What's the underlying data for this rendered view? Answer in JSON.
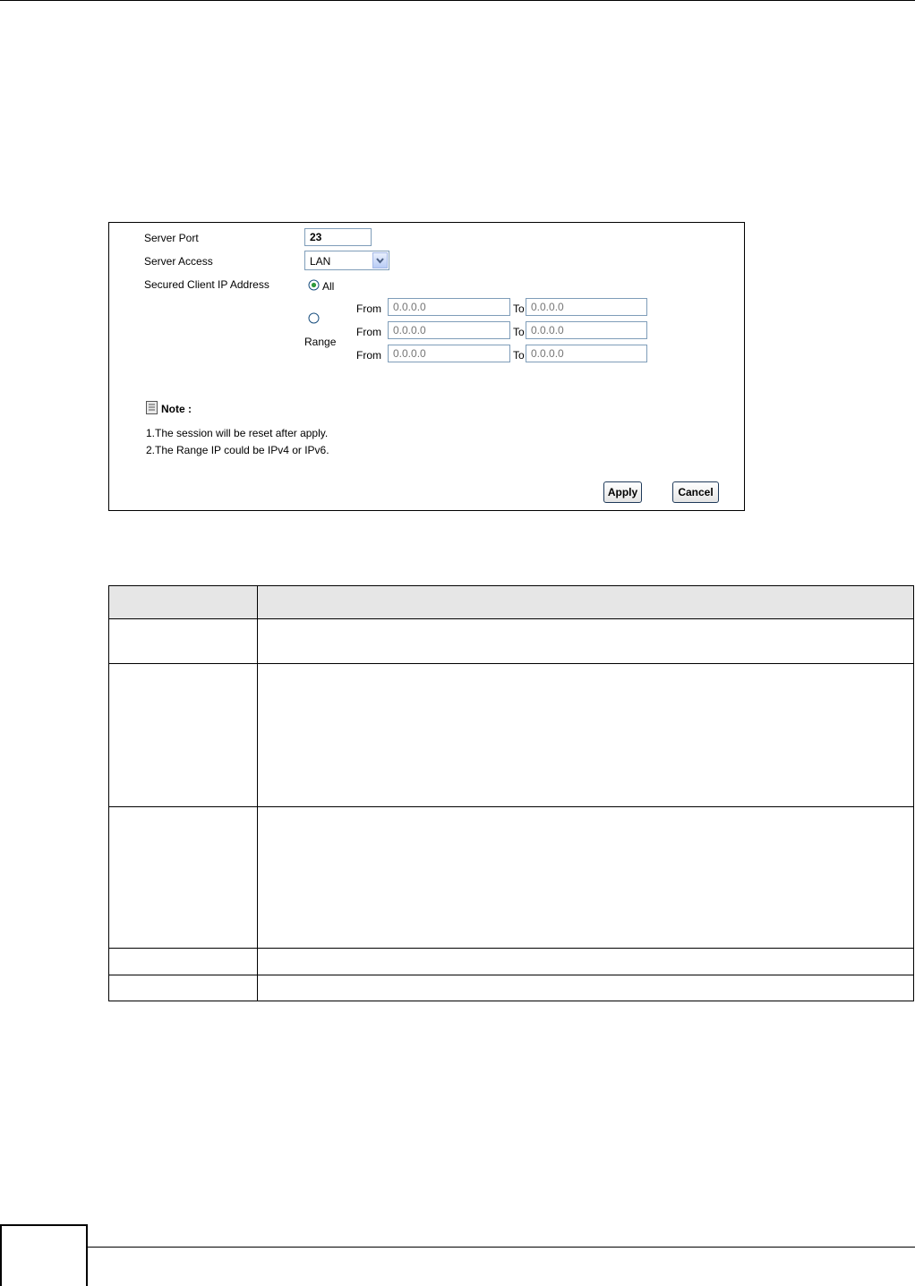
{
  "form": {
    "server_port_label": "Server Port",
    "server_port_value": "23",
    "server_access_label": "Server Access",
    "server_access_value": "LAN",
    "secured_client_label": "Secured Client IP Address",
    "option_all": "All",
    "option_range": "Range",
    "selected_option": "All",
    "ranges": [
      {
        "from_label": "From",
        "from_placeholder": "0.0.0.0",
        "to_label": "To",
        "to_placeholder": "0.0.0.0"
      },
      {
        "from_label": "From",
        "from_placeholder": "0.0.0.0",
        "to_label": "To",
        "to_placeholder": "0.0.0.0"
      },
      {
        "from_label": "From",
        "from_placeholder": "0.0.0.0",
        "to_label": "To",
        "to_placeholder": "0.0.0.0"
      }
    ],
    "note_title": "Note :",
    "notes": [
      "1.The session will be reset after apply.",
      "2.The Range IP could be IPv4 or IPv6."
    ],
    "apply_label": "Apply",
    "cancel_label": "Cancel"
  },
  "colors": {
    "table_header_bg": "#e6e6e6",
    "input_border": "#7f9db9",
    "radio_selected": "#2f9a3c"
  },
  "icons": [
    "note-icon",
    "chevron-down-icon"
  ]
}
